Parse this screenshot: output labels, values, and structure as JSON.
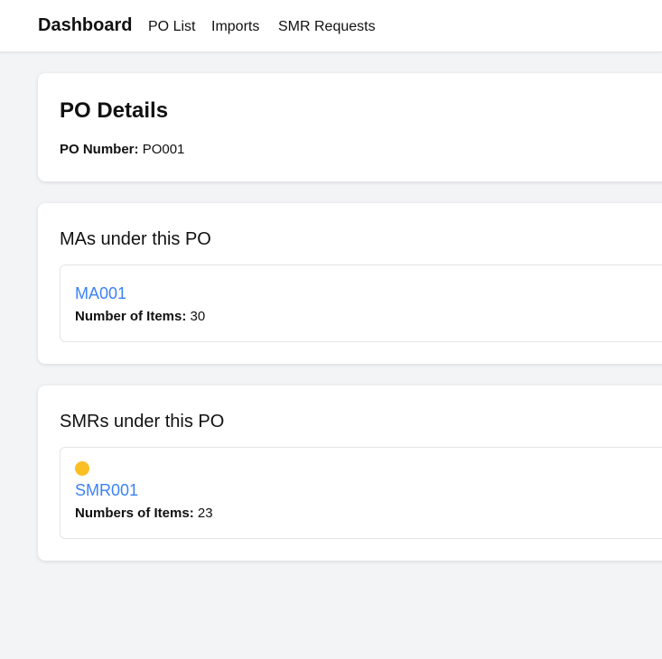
{
  "nav": {
    "brand": "Dashboard",
    "links": [
      "PO List",
      "Imports",
      "SMR Requests"
    ]
  },
  "po_details": {
    "title": "PO Details",
    "number_label": "PO Number:",
    "number_value": "PO001"
  },
  "mas": {
    "title": "MAs under this PO",
    "items": [
      {
        "id": "MA001",
        "count_label": "Number of Items:",
        "count_value": "30"
      }
    ]
  },
  "smrs": {
    "title": "SMRs under this PO",
    "items": [
      {
        "id": "SMR001",
        "status_icon": "status-dot-icon",
        "status_color": "#fbbf24",
        "count_label": "Numbers of Items:",
        "count_value": "23"
      }
    ]
  },
  "colors": {
    "link": "#3b82f6",
    "background": "#f3f4f6"
  }
}
